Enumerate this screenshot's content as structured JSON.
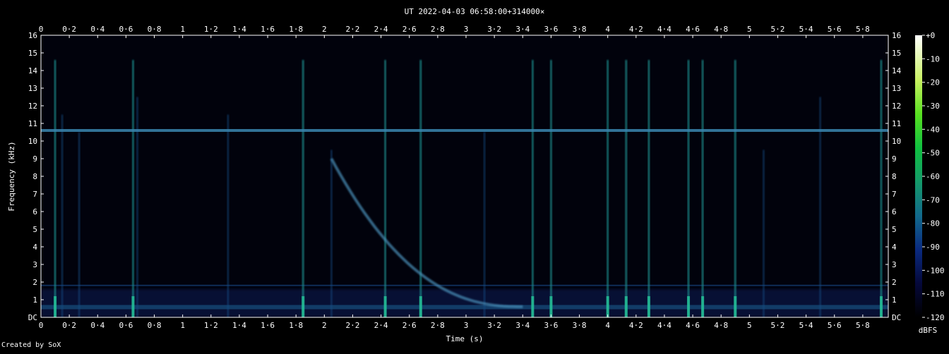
{
  "title": "UT 2022-04-03 06:58:00+314000×",
  "footer": "Created by SoX",
  "chart_data": {
    "type": "heatmap",
    "title": "UT 2022-04-03 06:58:00+314000×",
    "xlabel": "Time (s)",
    "ylabel": "Frequency (kHz)",
    "xlim": [
      0,
      5.98
    ],
    "ylim": [
      0,
      16
    ],
    "x_ticks": [
      "0",
      "0·2",
      "0·4",
      "0·6",
      "0·8",
      "1",
      "1·2",
      "1·4",
      "1·6",
      "1·8",
      "2",
      "2·2",
      "2·4",
      "2·6",
      "2·8",
      "3",
      "3·2",
      "3·4",
      "3·6",
      "3·8",
      "4",
      "4·2",
      "4·4",
      "4·6",
      "4·8",
      "5",
      "5·2",
      "5·4",
      "5·6",
      "5·8"
    ],
    "y_ticks": [
      "DC",
      "1",
      "2",
      "3",
      "4",
      "5",
      "6",
      "7",
      "8",
      "9",
      "10",
      "11",
      "12",
      "13",
      "14",
      "15",
      "16"
    ],
    "colorbar": {
      "label": "dBFS",
      "ticks": [
        "+0",
        "-10",
        "-20",
        "-30",
        "-40",
        "-50",
        "-60",
        "-70",
        "-80",
        "-90",
        "-100",
        "-110",
        "-120"
      ],
      "range": [
        -120,
        0
      ]
    },
    "features": {
      "carrier_khz": 10.6,
      "whistler": {
        "t_start": 2.05,
        "f_start_khz": 9.0,
        "t_end": 3.4,
        "f_end_khz": 0.6
      },
      "sferics_s": [
        0.1,
        0.15,
        0.27,
        0.65,
        0.68,
        1.32,
        1.85,
        2.05,
        2.43,
        2.68,
        3.13,
        3.47,
        3.6,
        4.0,
        4.13,
        4.29,
        4.57,
        4.67,
        4.9,
        5.1,
        5.5,
        5.93
      ]
    }
  }
}
